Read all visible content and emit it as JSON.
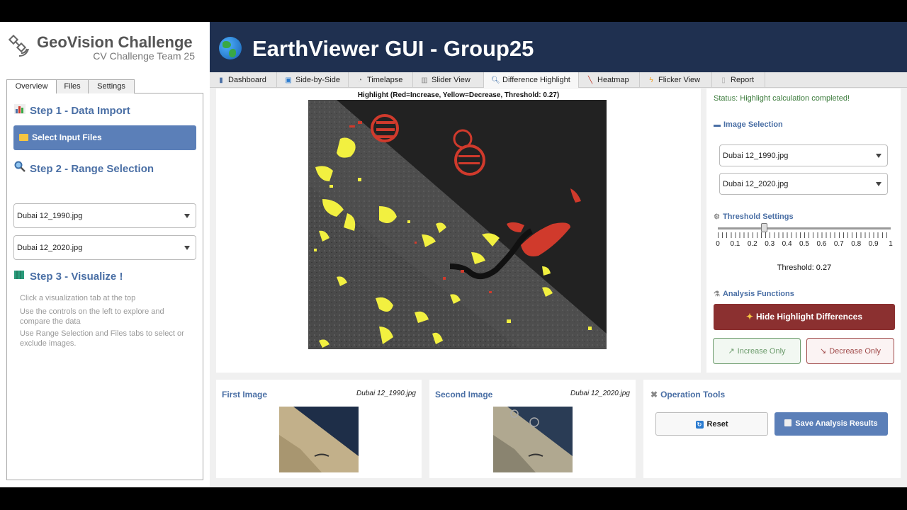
{
  "brand": {
    "title": "GeoVision Challenge",
    "subtitle": "CV Challenge Team 25"
  },
  "sidebar": {
    "tabs": [
      "Overview",
      "Files",
      "Settings"
    ],
    "step1": "Step 1 - Data Import",
    "select_files": "Select Input Files",
    "step2": "Step 2 - Range Selection",
    "range_start": "Dubai 12_1990.jpg",
    "range_end": "Dubai 12_2020.jpg",
    "step3": "Step 3 - Visualize !",
    "hints": [
      "Click a visualization tab at the top",
      "Use the controls on the left to explore and compare the data",
      "Use Range Selection and Files tabs to select or exclude images."
    ]
  },
  "header": {
    "title": "EarthViewer GUI - Group25"
  },
  "tabs": [
    {
      "label": "Dashboard",
      "icon": "chart-icon"
    },
    {
      "label": "Side-by-Side",
      "icon": "split-icon"
    },
    {
      "label": "Timelapse",
      "icon": "clock-icon"
    },
    {
      "label": "Slider View",
      "icon": "slider-icon"
    },
    {
      "label": "Difference Highlight",
      "icon": "search-icon"
    },
    {
      "label": "Heatmap",
      "icon": "pen-icon"
    },
    {
      "label": "Flicker View",
      "icon": "flash-icon"
    },
    {
      "label": "Report",
      "icon": "doc-icon"
    }
  ],
  "viz": {
    "title": "Highlight (Red=Increase, Yellow=Decrease, Threshold: 0.27)"
  },
  "controls": {
    "status": "Status: Highlight calculation completed!",
    "image_selection": "Image Selection",
    "image1": "Dubai 12_1990.jpg",
    "image2": "Dubai 12_2020.jpg",
    "threshold_settings": "Threshold Settings",
    "threshold": 0.27,
    "tick_labels": [
      "0",
      "0.1",
      "0.2",
      "0.3",
      "0.4",
      "0.5",
      "0.6",
      "0.7",
      "0.8",
      "0.9",
      "1"
    ],
    "threshold_label": "Threshold: 0.27",
    "analysis_functions": "Analysis Functions",
    "hide_button": "Hide Highlight Differences",
    "increase_button": "Increase Only",
    "decrease_button": "Decrease Only"
  },
  "first_image": {
    "title": "First Image",
    "file": "Dubai 12_1990.jpg"
  },
  "second_image": {
    "title": "Second Image",
    "file": "Dubai 12_2020.jpg"
  },
  "tools": {
    "title": "Operation Tools",
    "reset": "Reset",
    "save": "Save Analysis Results"
  },
  "colors": {
    "accent": "#4a6fa5",
    "header": "#1f3050",
    "danger": "#8b3030",
    "increase": "#d03a2c",
    "decrease": "#f2f040"
  }
}
